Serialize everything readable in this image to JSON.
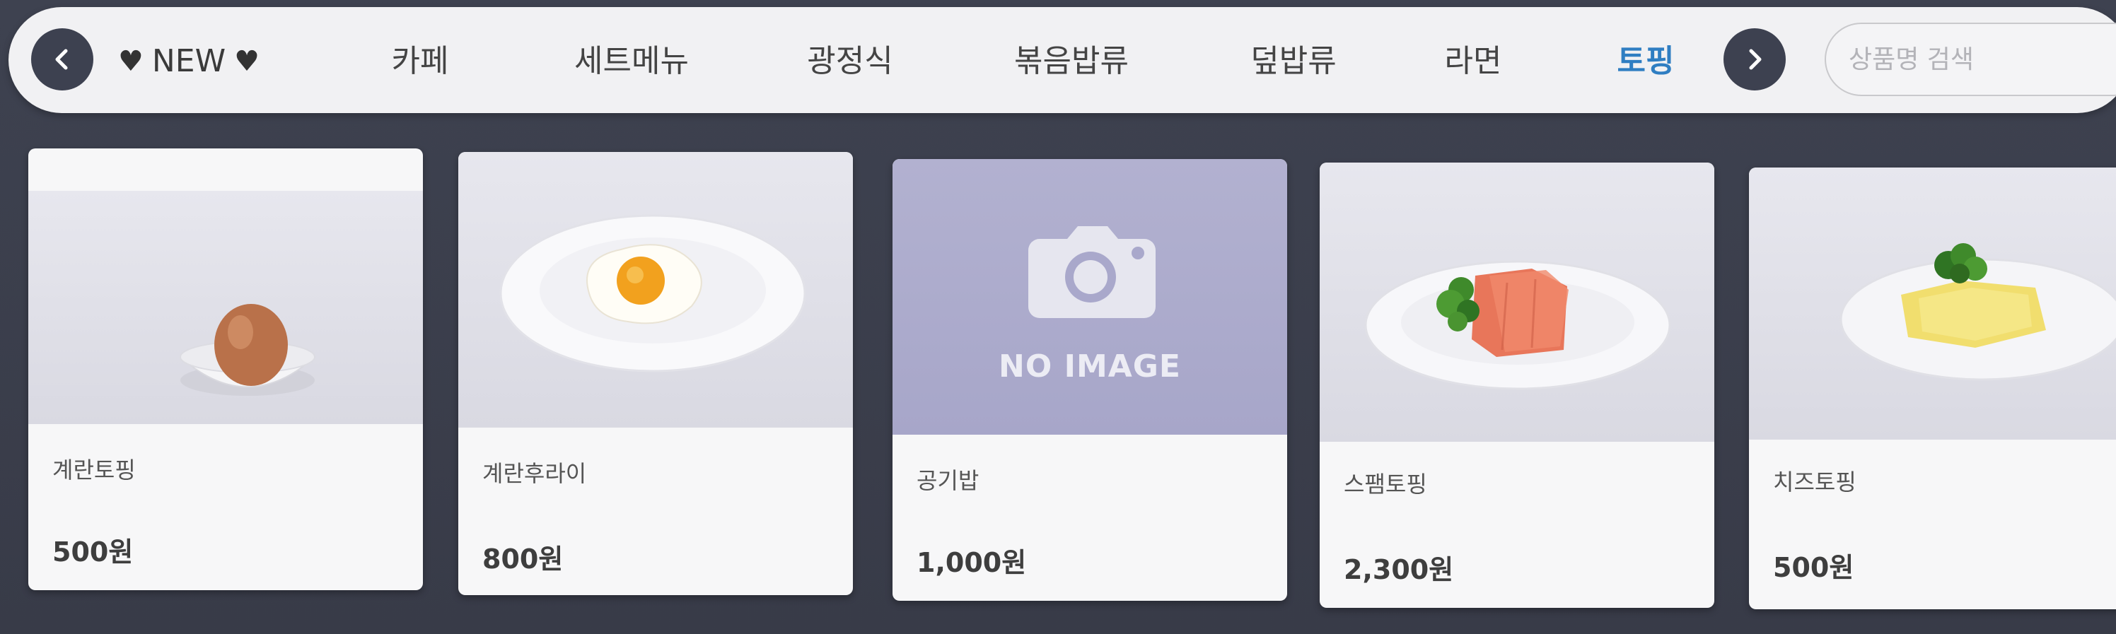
{
  "nav": {
    "prev_arrow": "chevron-left-icon",
    "next_arrow": "chevron-right-icon",
    "new_tab": {
      "heart_left": "♥",
      "label": "NEW",
      "heart_right": "♥"
    },
    "tabs": [
      {
        "label": "카페"
      },
      {
        "label": "세트메뉴"
      },
      {
        "label": "광정식"
      },
      {
        "label": "볶음밥류"
      },
      {
        "label": "덮밥류"
      },
      {
        "label": "라면"
      },
      {
        "label": "토핑",
        "active": true
      }
    ],
    "active_color": "#2f7ec2"
  },
  "search": {
    "placeholder": "상품명 검색",
    "value": ""
  },
  "products": [
    {
      "name": "계란토핑",
      "price": "500원",
      "image": "boiled-egg"
    },
    {
      "name": "계란후라이",
      "price": "800원",
      "image": "fried-egg"
    },
    {
      "name": "공기밥",
      "price": "1,000원",
      "image": "no-image",
      "no_image_text": "NO IMAGE"
    },
    {
      "name": "스팸토핑",
      "price": "2,300원",
      "image": "spam"
    },
    {
      "name": "치즈토핑",
      "price": "500원",
      "image": "cheese"
    }
  ]
}
